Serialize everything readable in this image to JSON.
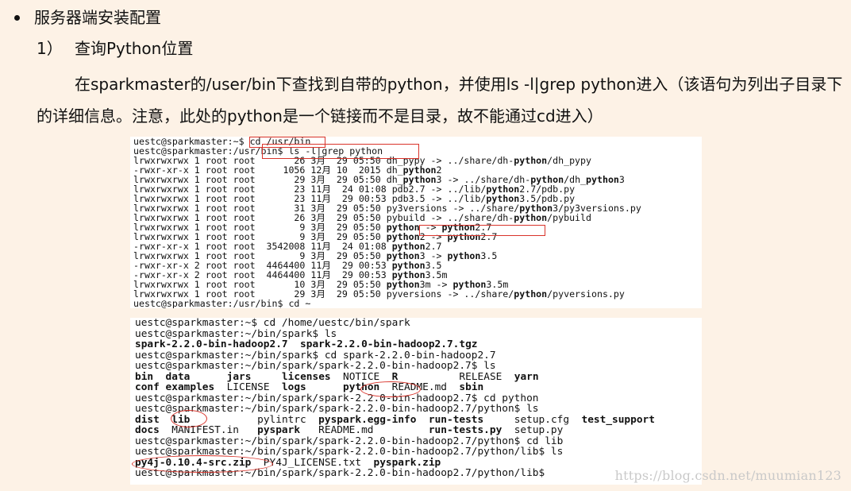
{
  "heading": "服务器端安装配置",
  "step": {
    "number": "1）",
    "title": "查询Python位置"
  },
  "paragraph": "在sparkmaster的/user/bin下查找到自带的python，并使用ls -l|grep python进入（该语句为列出子目录下的详细信息。注意，此处的python是一个链接而不是目录，故不能通过cd进入）",
  "terminal1": {
    "lines": [
      [
        {
          "t": "uestc@sparkmaster:~$ cd /usr/bin"
        }
      ],
      [
        {
          "t": "uestc@sparkmaster:/usr/bin$ ls -l|grep python"
        }
      ],
      [
        {
          "t": "lrwxrwxrwx 1 root root       26 3月  29 05:50 dh_pypy -> ../share/dh-"
        },
        {
          "t": "python",
          "b": true
        },
        {
          "t": "/dh_pypy"
        }
      ],
      [
        {
          "t": "-rwxr-xr-x 1 root root     1056 12月 10  2015 dh_"
        },
        {
          "t": "python",
          "b": true
        },
        {
          "t": "2"
        }
      ],
      [
        {
          "t": "lrwxrwxrwx 1 root root       29 3月  29 05:50 dh_"
        },
        {
          "t": "python",
          "b": true
        },
        {
          "t": "3 -> ../share/dh-"
        },
        {
          "t": "python",
          "b": true
        },
        {
          "t": "/dh_"
        },
        {
          "t": "python",
          "b": true
        },
        {
          "t": "3"
        }
      ],
      [
        {
          "t": "lrwxrwxrwx 1 root root       23 11月  24 01:08 pdb2.7 -> ../lib/"
        },
        {
          "t": "python",
          "b": true
        },
        {
          "t": "2.7/pdb.py"
        }
      ],
      [
        {
          "t": "lrwxrwxrwx 1 root root       23 11月  29 00:53 pdb3.5 -> ../lib/"
        },
        {
          "t": "python",
          "b": true
        },
        {
          "t": "3.5/pdb.py"
        }
      ],
      [
        {
          "t": "lrwxrwxrwx 1 root root       31 3月  29 05:50 py3versions -> ../share/"
        },
        {
          "t": "python",
          "b": true
        },
        {
          "t": "3/py3versions.py"
        }
      ],
      [
        {
          "t": "lrwxrwxrwx 1 root root       26 3月  29 05:50 pybuild -> ../share/dh-"
        },
        {
          "t": "python",
          "b": true
        },
        {
          "t": "/pybuild"
        }
      ],
      [
        {
          "t": "lrwxrwxrwx 1 root root        9 3月  29 05:50 "
        },
        {
          "t": "python",
          "b": true
        },
        {
          "t": " -> "
        },
        {
          "t": "python",
          "b": true
        },
        {
          "t": "2.7"
        }
      ],
      [
        {
          "t": "lrwxrwxrwx 1 root root        9 3月  29 05:50 "
        },
        {
          "t": "python",
          "b": true
        },
        {
          "t": "2 -> "
        },
        {
          "t": "python",
          "b": true
        },
        {
          "t": "2.7"
        }
      ],
      [
        {
          "t": "-rwxr-xr-x 1 root root  3542008 11月  24 01:08 "
        },
        {
          "t": "python",
          "b": true
        },
        {
          "t": "2.7"
        }
      ],
      [
        {
          "t": "lrwxrwxrwx 1 root root        9 3月  29 05:50 "
        },
        {
          "t": "python",
          "b": true
        },
        {
          "t": "3 -> "
        },
        {
          "t": "python",
          "b": true
        },
        {
          "t": "3.5"
        }
      ],
      [
        {
          "t": "-rwxr-xr-x 2 root root  4464400 11月  29 00:53 "
        },
        {
          "t": "python",
          "b": true
        },
        {
          "t": "3.5"
        }
      ],
      [
        {
          "t": "-rwxr-xr-x 2 root root  4464400 11月  29 00:53 "
        },
        {
          "t": "python",
          "b": true
        },
        {
          "t": "3.5m"
        }
      ],
      [
        {
          "t": "lrwxrwxrwx 1 root root       10 3月  29 05:50 "
        },
        {
          "t": "python",
          "b": true
        },
        {
          "t": "3m -> "
        },
        {
          "t": "python",
          "b": true
        },
        {
          "t": "3.5m"
        }
      ],
      [
        {
          "t": "lrwxrwxrwx 1 root root       29 3月  29 05:50 pyversions -> ../share/"
        },
        {
          "t": "python",
          "b": true
        },
        {
          "t": "/pyversions.py"
        }
      ],
      [
        {
          "t": "uestc@sparkmaster:/usr/bin$ cd ~"
        }
      ]
    ]
  },
  "terminal2": {
    "lines": [
      [
        {
          "t": "uestc@sparkmaster:~$ cd /home/uestc/bin/spark"
        }
      ],
      [
        {
          "t": "uestc@sparkmaster:~/bin/spark$ ls"
        }
      ],
      [
        {
          "t": "spark-2.2.0-bin-hadoop2.7",
          "b": true
        },
        {
          "t": "  "
        },
        {
          "t": "spark-2.2.0-bin-hadoop2.7.tgz",
          "b": true
        }
      ],
      [
        {
          "t": "uestc@sparkmaster:~/bin/spark$ cd spark-2.2.0-bin-hadoop2.7"
        }
      ],
      [
        {
          "t": "uestc@sparkmaster:~/bin/spark/spark-2.2.0-bin-hadoop2.7$ ls"
        }
      ],
      [
        {
          "t": "bin",
          "b": true
        },
        {
          "t": "  "
        },
        {
          "t": "data",
          "b": true
        },
        {
          "t": "      "
        },
        {
          "t": "jars",
          "b": true
        },
        {
          "t": "     "
        },
        {
          "t": "licenses",
          "b": true
        },
        {
          "t": "  NOTICE  "
        },
        {
          "t": "R",
          "b": true
        },
        {
          "t": "          RELEASE  "
        },
        {
          "t": "yarn",
          "b": true
        }
      ],
      [
        {
          "t": "conf",
          "b": true
        },
        {
          "t": " "
        },
        {
          "t": "examples",
          "b": true
        },
        {
          "t": "  LICENSE  "
        },
        {
          "t": "logs",
          "b": true
        },
        {
          "t": "      "
        },
        {
          "t": "python",
          "b": true
        },
        {
          "t": "  README.md  "
        },
        {
          "t": "sbin",
          "b": true
        }
      ],
      [
        {
          "t": "uestc@sparkmaster:~/bin/spark/spark-2.2.0-bin-hadoop2.7$ cd python"
        }
      ],
      [
        {
          "t": "uestc@sparkmaster:~/bin/spark/spark-2.2.0-bin-hadoop2.7/python$ ls"
        }
      ],
      [
        {
          "t": "dist",
          "b": true
        },
        {
          "t": "  "
        },
        {
          "t": "lib",
          "b": true
        },
        {
          "t": "           pylintrc  "
        },
        {
          "t": "pyspark.egg-info",
          "b": true
        },
        {
          "t": "  "
        },
        {
          "t": "run-tests",
          "b": true
        },
        {
          "t": "     setup.cfg  "
        },
        {
          "t": "test_support",
          "b": true
        }
      ],
      [
        {
          "t": "docs",
          "b": true
        },
        {
          "t": "  MANIFEST.in   "
        },
        {
          "t": "pyspark",
          "b": true
        },
        {
          "t": "   README.md         "
        },
        {
          "t": "run-tests.py",
          "b": true
        },
        {
          "t": "  setup.py"
        }
      ],
      [
        {
          "t": "uestc@sparkmaster:~/bin/spark/spark-2.2.0-bin-hadoop2.7/python$ cd lib"
        }
      ],
      [
        {
          "t": "uestc@sparkmaster:~/bin/spark/spark-2.2.0-bin-hadoop2.7/python/lib$ ls"
        }
      ],
      [
        {
          "t": "py4j-0.10.4-src.zip",
          "b": true
        },
        {
          "t": "  PY4J_LICENSE.txt  "
        },
        {
          "t": "pyspark.zip",
          "b": true
        }
      ],
      [
        {
          "t": "uestc@sparkmaster:~/bin/spark/spark-2.2.0-bin-hadoop2.7/python/lib$"
        }
      ]
    ]
  },
  "watermark": "https://blog.csdn.net/muumian123",
  "colors": {
    "page_background": "#fdf2e6",
    "highlight": "#d9342b",
    "terminal_background": "#ffffff"
  }
}
